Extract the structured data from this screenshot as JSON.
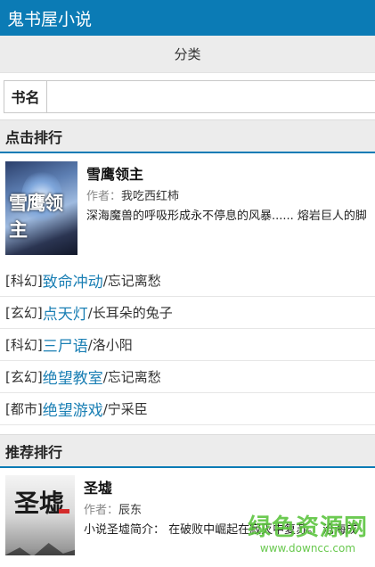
{
  "header": {
    "title": "鬼书屋小说"
  },
  "category": {
    "label": "分类"
  },
  "search": {
    "label": "书名",
    "value": "",
    "placeholder": ""
  },
  "click_rank": {
    "heading": "点击排行",
    "featured": {
      "cover_text": "雪鹰领主",
      "title": "雪鹰领主",
      "author_label": "作者：",
      "author": "我吃西红柿",
      "desc": "深海魔兽的呼吸形成永不停息的风暴...... 熔岩巨人的脚"
    },
    "items": [
      {
        "genre": "[科幻]",
        "name": "致命冲动",
        "sep": "/",
        "author": "忘记离愁"
      },
      {
        "genre": "[玄幻]",
        "name": "点天灯",
        "sep": "/",
        "author": "长耳朵的兔子"
      },
      {
        "genre": "[科幻]",
        "name": "三尸语",
        "sep": "/",
        "author": "洛小阳"
      },
      {
        "genre": "[玄幻]",
        "name": "绝望教室",
        "sep": "/",
        "author": "忘记离愁"
      },
      {
        "genre": "[都市]",
        "name": "绝望游戏",
        "sep": "/",
        "author": "宁采臣"
      }
    ]
  },
  "recommend_rank": {
    "heading": "推荐排行",
    "featured": {
      "cover_text": "圣墟",
      "title": "圣墟",
      "author_label": "作者：",
      "author": "辰东",
      "desc": "小说圣墟简介： 在破败中崛起在寂灭中复苏。 沧海成"
    }
  },
  "watermark": {
    "cn": "绿色资源网",
    "url": "www.downcc.com"
  },
  "colors": {
    "header_bg": "#0b7bb5",
    "link": "#1a7fb4",
    "watermark": "#58c33b"
  }
}
